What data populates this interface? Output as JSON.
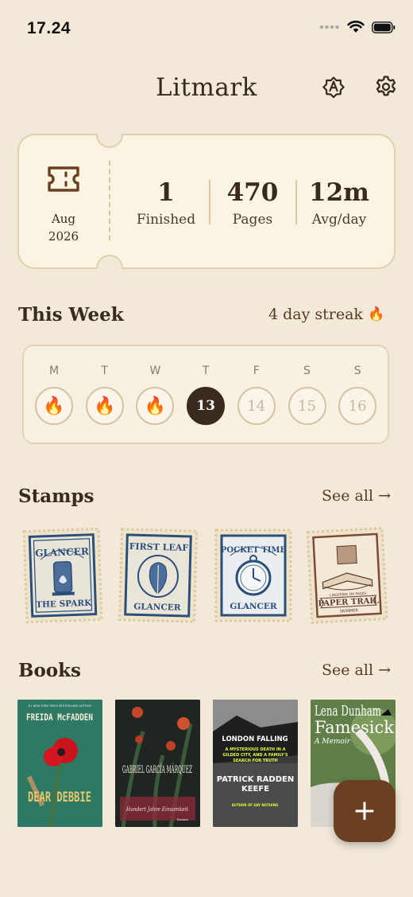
{
  "status": {
    "time": "17.24"
  },
  "header": {
    "title": "Litmark"
  },
  "summary": {
    "month": "Aug",
    "year": "2026",
    "stats": [
      {
        "value": "1",
        "label": "Finished"
      },
      {
        "value": "470",
        "label": "Pages"
      },
      {
        "value": "12m",
        "label": "Avg/day"
      }
    ]
  },
  "week": {
    "title": "This Week",
    "streak": "4 day streak",
    "days": [
      {
        "letter": "M",
        "value": "",
        "state": "done"
      },
      {
        "letter": "T",
        "value": "",
        "state": "done"
      },
      {
        "letter": "W",
        "value": "",
        "state": "done"
      },
      {
        "letter": "T",
        "value": "13",
        "state": "today"
      },
      {
        "letter": "F",
        "value": "14",
        "state": "future"
      },
      {
        "letter": "S",
        "value": "15",
        "state": "future"
      },
      {
        "letter": "S",
        "value": "16",
        "state": "future"
      }
    ]
  },
  "stamps": {
    "title": "Stamps",
    "see_all": "See all →",
    "items": [
      {
        "top": "GLANCER",
        "bottom": "THE SPARK"
      },
      {
        "top": "FIRST LEAF",
        "bottom": "GLANCER"
      },
      {
        "top": "POCKET TIME",
        "bottom": "GLANCER"
      },
      {
        "top": "LINGERING ON PAGES",
        "bottom": "PAPER TRAIL",
        "sub": "SKIMMER"
      }
    ]
  },
  "books": {
    "title": "Books",
    "see_all": "See all →",
    "items": [
      {
        "tagline": "#1 NEW YORK TIMES BESTSELLING AUTHOR",
        "author": "FREIDA McFADDEN",
        "title": "DEAR DEBBIE"
      },
      {
        "author": "GABRIEL GARCÍA MÁRQUEZ",
        "title": "Hundert Jahre Einsamkeit",
        "note": "Roman"
      },
      {
        "title": "LONDON FALLING",
        "tagline": "A MYSTERIOUS DEATH IN A GILDED CITY, AND A FAMILY'S SEARCH FOR TRUTH",
        "author": "PATRICK RADDEN KEEFE",
        "note": "AUTHOR OF SAY NOTHING"
      },
      {
        "author": "Lena Dunham",
        "title": "Famesick",
        "note": "A Memoir"
      }
    ]
  },
  "fab": {
    "label": "+"
  }
}
